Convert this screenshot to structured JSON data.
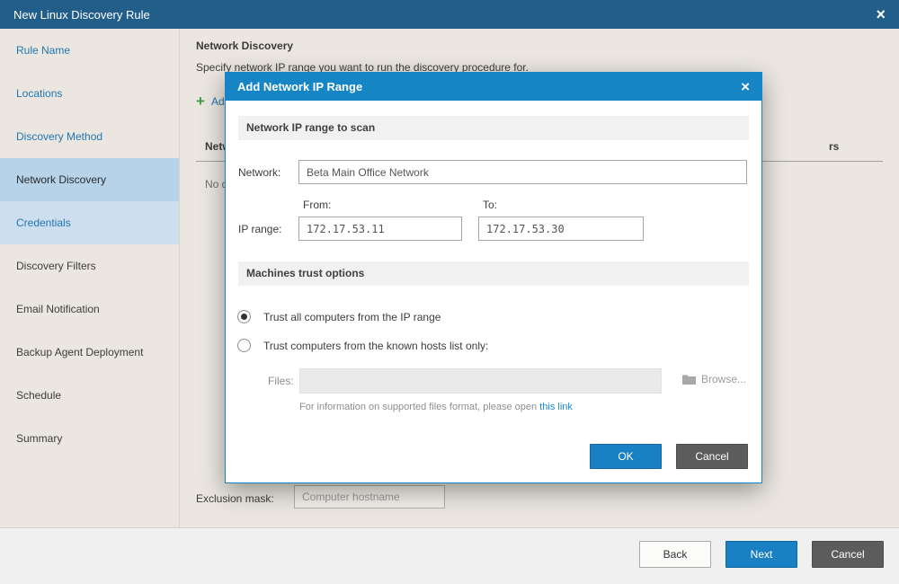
{
  "window": {
    "title": "New Linux Discovery Rule",
    "close_icon": "×"
  },
  "sidebar": {
    "items": [
      {
        "label": "Rule Name",
        "state": "done"
      },
      {
        "label": "Locations",
        "state": "done"
      },
      {
        "label": "Discovery Method",
        "state": "done"
      },
      {
        "label": "Network Discovery",
        "state": "current"
      },
      {
        "label": "Credentials",
        "state": "next"
      },
      {
        "label": "Discovery Filters",
        "state": "future"
      },
      {
        "label": "Email Notification",
        "state": "future"
      },
      {
        "label": "Backup Agent Deployment",
        "state": "future"
      },
      {
        "label": "Schedule",
        "state": "future"
      },
      {
        "label": "Summary",
        "state": "future"
      }
    ]
  },
  "main": {
    "heading": "Network Discovery",
    "description": "Specify network IP range you want to run the discovery procedure for.",
    "add_button": {
      "icon": "+",
      "label": "Add..."
    },
    "table": {
      "column1": "Network",
      "column2_fragment": "rs"
    },
    "empty_text": "No discovery ranges added.",
    "exclusion": {
      "label": "Exclusion mask:",
      "placeholder": "Computer hostname"
    }
  },
  "footer": {
    "back": "Back",
    "next": "Next",
    "cancel": "Cancel"
  },
  "modal": {
    "title": "Add Network IP Range",
    "close_icon": "×",
    "sections": {
      "range": "Network IP range to scan",
      "trust": "Machines trust options"
    },
    "network": {
      "label": "Network:",
      "value": "Beta Main Office Network"
    },
    "ip_range": {
      "label": "IP range:",
      "from_label": "From:",
      "to_label": "To:",
      "from_value": "172.17.53.11",
      "to_value": "172.17.53.30"
    },
    "trust_options": [
      {
        "label": "Trust all computers from the IP range",
        "selected": true
      },
      {
        "label": "Trust computers from the known hosts list only:",
        "selected": false
      }
    ],
    "files": {
      "label": "Files:",
      "value": "",
      "browse": "Browse..."
    },
    "hint": {
      "text": "For information on supported files format, please open ",
      "link": "this link"
    },
    "ok": "OK",
    "cancel": "Cancel"
  },
  "colors": {
    "titlebar": "#215e89",
    "modal_accent": "#1585c5",
    "primary_button": "#1a80c4",
    "dark_button": "#5c5c5c",
    "sidebar_selected": "#b7d3e9",
    "link": "#1f76b4",
    "add_green": "#3f9e42"
  }
}
